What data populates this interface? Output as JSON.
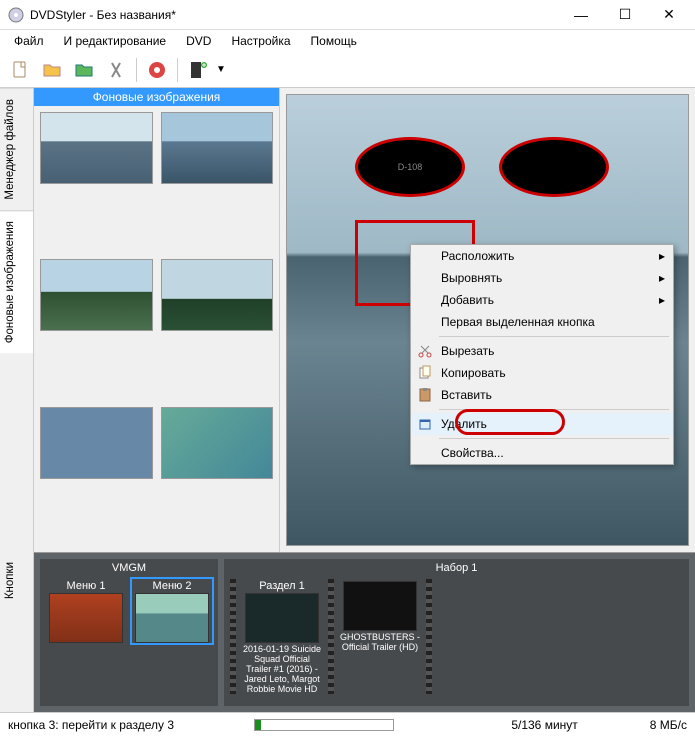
{
  "window": {
    "title": "DVDStyler - Без названия*",
    "controls": {
      "minimize": "—",
      "maximize": "☐",
      "close": "✕"
    }
  },
  "menubar": {
    "file": "Файл",
    "edit": "И редактирование",
    "dvd": "DVD",
    "settings": "Настройка",
    "help": "Помощь"
  },
  "sidetabs": {
    "file_manager": "Менеджер файлов",
    "backgrounds": "Фоновые изображения",
    "buttons": "Кнопки"
  },
  "panel_title": "Фоновые изображения",
  "preview": {
    "btn_labels": [
      "D-108",
      ""
    ]
  },
  "timeline": {
    "vmgm_title": "VMGM",
    "set1_title": "Набор 1",
    "menu1": "Меню 1",
    "menu2": "Меню 2",
    "section1": "Раздел 1",
    "caption1": "2016-01-19 Suicide Squad Official Trailer #1 (2016) - Jared Leto, Margot Robbie Movie HD",
    "caption2": "GHOSTBUSTERS - Official Trailer (HD)"
  },
  "context_menu": {
    "arrange": "Расположить",
    "align": "Выровнять",
    "add": "Добавить",
    "first_selected": "Первая выделенная кнопка",
    "cut": "Вырезать",
    "copy": "Копировать",
    "paste": "Вставить",
    "delete": "Удалить",
    "properties": "Свойства..."
  },
  "status": {
    "text": "кнопка 3: перейти к разделу 3",
    "time": "5/136 минут",
    "size": "8 МБ/с"
  },
  "colors": {
    "accent": "#3399ff",
    "ring": "#c00000"
  }
}
